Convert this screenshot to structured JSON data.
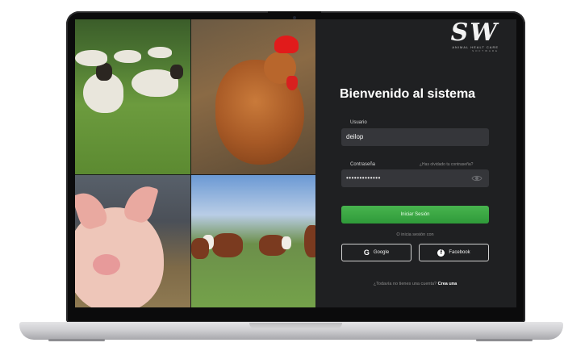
{
  "brand": {
    "logo": "SW",
    "tagline": "ANIMAL HEALT CARE",
    "sub": "SOFTWARE"
  },
  "login": {
    "title": "Bienvenido al sistema",
    "user_label": "Usuario",
    "user_value": "deilop",
    "password_label": "Contraseña",
    "password_value": "•••••••••••••",
    "forgot_link": "¿Has olvidado tu contraseña?",
    "submit_label": "Iniciar Sesión",
    "or_text": "O inicia sesión con",
    "google_label": "Google",
    "facebook_label": "Facebook",
    "signup_prompt": "¿Todavía no tienes una cuenta?",
    "signup_link": "Crea una"
  },
  "images": {
    "sheep": "sheep-photo",
    "hen": "hen-photo",
    "pig": "pig-photo",
    "cows": "cows-photo"
  },
  "colors": {
    "accent_green": "#3aa843",
    "panel_bg": "#1f2022",
    "input_bg": "#35363a"
  }
}
